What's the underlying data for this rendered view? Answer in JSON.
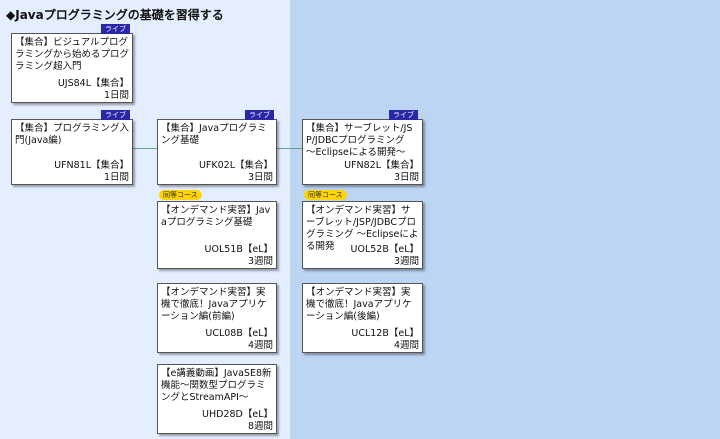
{
  "page": {
    "title": "◆Javaプログラミングの基礎を習得する"
  },
  "colors": {
    "left_panel": "#e3efff",
    "right_panel": "#bcd5f3",
    "live_badge": "#2828a8",
    "equiv_badge": "#ffd400"
  },
  "badges": {
    "live": "ライブ",
    "equivalent": "同等コース"
  },
  "cards": {
    "c1": {
      "title": "【集合】ビジュアルプログラミングから始めるプログラミング超入門",
      "code": "UJS84L【集合】",
      "duration": "1日間"
    },
    "c2": {
      "title": "【集合】プログラミング入門(Java編)",
      "code": "UFN81L【集合】",
      "duration": "1日間"
    },
    "c3": {
      "title": "【集合】Javaプログラミング基礎",
      "code": "UFK02L【集合】",
      "duration": "3日間"
    },
    "c4": {
      "title": "【集合】サーブレット/JSP/JDBCプログラミング　～Eclipseによる開発～",
      "code": "UFN82L【集合】",
      "duration": "3日間"
    },
    "c5": {
      "title": "【オンデマンド実習】Javaプログラミング基礎",
      "code": "UOL51B【eL】",
      "duration": "3週間"
    },
    "c6": {
      "title": "【オンデマンド実習】サーブレット/JSP/JDBCプログラミング ～Eclipseによる開発",
      "code": "UOL52B【eL】",
      "duration": "3週間"
    },
    "c7": {
      "title": "【オンデマンド実習】実機で徹底！Javaアプリケーション編(前編)",
      "code": "UCL08B【eL】",
      "duration": "4週間"
    },
    "c8": {
      "title": "【オンデマンド実習】実機で徹底！Javaアプリケーション編(後編)",
      "code": "UCL12B【eL】",
      "duration": "4週間"
    },
    "c9": {
      "title": "【e講義動画】JavaSE8新機能～関数型プログラミングとStreamAPI～",
      "code": "UHD28D【eL】",
      "duration": "8週間"
    }
  }
}
